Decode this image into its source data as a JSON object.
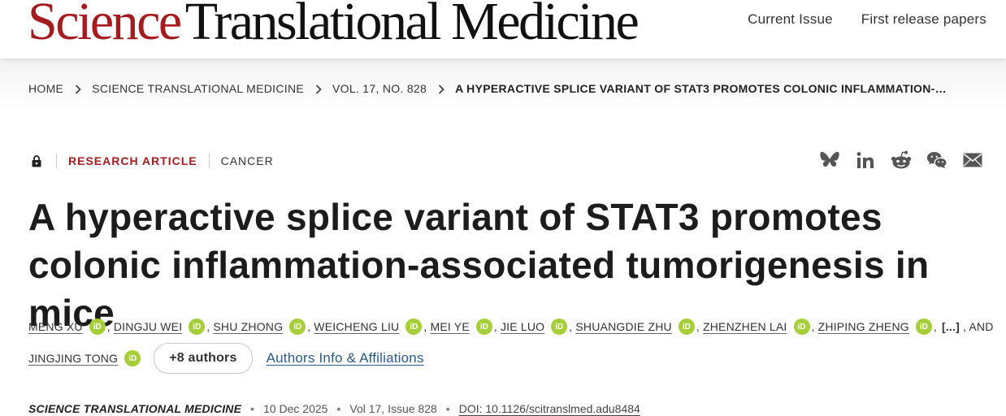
{
  "header": {
    "logo_primary": "Science",
    "logo_secondary": "Translational Medicine",
    "nav": [
      "Current Issue",
      "First release papers"
    ],
    "brand_color": "#a51c20"
  },
  "breadcrumb": [
    "HOME",
    "SCIENCE TRANSLATIONAL MEDICINE",
    "VOL. 17, NO. 828",
    "A HYPERACTIVE SPLICE VARIANT OF STAT3 PROMOTES COLONIC INFLAMMATION-…"
  ],
  "meta": {
    "article_type": "RESEARCH ARTICLE",
    "subject": "CANCER"
  },
  "share_icons": [
    "bluesky-icon",
    "linkedin-icon",
    "reddit-icon",
    "wechat-icon",
    "email-icon"
  ],
  "title": "A hyperactive splice variant of STAT3 promotes colonic inflammation-associated tumorigenesis in mice",
  "authors": {
    "line1": [
      "MENG XU",
      "DINGJU WEI",
      "SHU ZHONG",
      "WEICHENG LIU",
      "MEI YE",
      "JIE LUO",
      "SHUANGDIE ZHU",
      "ZHENZHEN LAI",
      "ZHIPING ZHENG"
    ],
    "ellipsis": "[...]",
    "and_text": ", AND",
    "last": "JINGJING TONG",
    "orcid_label": "iD",
    "more_button": "+8 authors",
    "info_link": "Authors Info & Affiliations"
  },
  "citation": {
    "journal": "SCIENCE TRANSLATIONAL MEDICINE",
    "date": "10 Dec 2025",
    "volume_issue": "Vol 17, Issue 828",
    "doi": "DOI: 10.1126/scitranslmed.adu8484"
  }
}
